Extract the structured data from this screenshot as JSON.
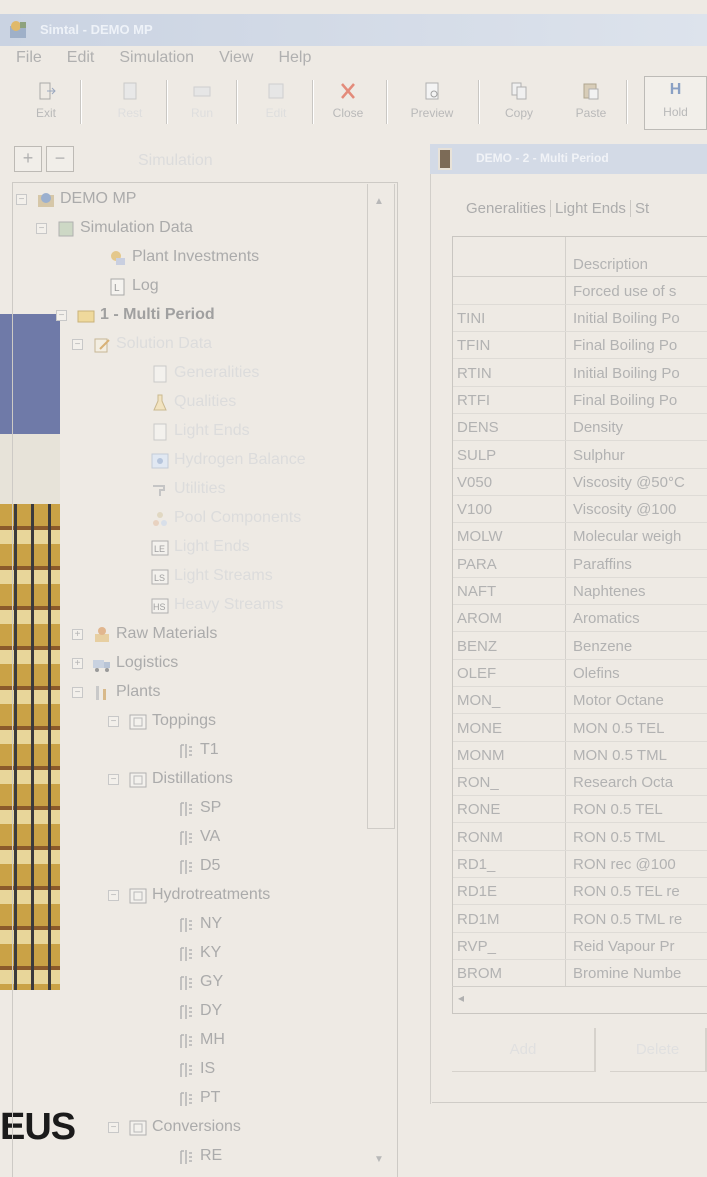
{
  "window": {
    "title": "Simtal - DEMO MP"
  },
  "menu": [
    "File",
    "Edit",
    "Simulation",
    "View",
    "Help"
  ],
  "toolbar": {
    "exit": "Exit",
    "b2": "Rest",
    "b3": "Run",
    "b4": "Edit",
    "close": "Close",
    "preview": "Preview",
    "copy": "Copy",
    "paste": "Paste",
    "hold": "Hold",
    "hold_icon": "H"
  },
  "tree": {
    "header_label": "Simulation",
    "expand_symbol": "+",
    "collapse_symbol": "−",
    "nodes": [
      {
        "label": "DEMO MP"
      },
      {
        "label": "Simulation Data"
      },
      {
        "label": "Plant Investments"
      },
      {
        "label": "Log"
      },
      {
        "label": "1 - Multi Period"
      },
      {
        "label": "Solution Data"
      },
      {
        "label": "Generalities"
      },
      {
        "label": "Qualities"
      },
      {
        "label": "Light Ends"
      },
      {
        "label": "Hydrogen Balance"
      },
      {
        "label": "Utilities"
      },
      {
        "label": "Pool Components"
      },
      {
        "label": "Light Ends"
      },
      {
        "label": "Light Streams"
      },
      {
        "label": "Heavy Streams"
      },
      {
        "label": "Raw Materials"
      },
      {
        "label": "Logistics"
      },
      {
        "label": "Plants"
      },
      {
        "label": "Toppings"
      },
      {
        "label": "T1"
      },
      {
        "label": "Distillations"
      },
      {
        "label": "SP"
      },
      {
        "label": "VA"
      },
      {
        "label": "D5"
      },
      {
        "label": "Hydrotreatments"
      },
      {
        "label": "NY"
      },
      {
        "label": "KY"
      },
      {
        "label": "GY"
      },
      {
        "label": "DY"
      },
      {
        "label": "MH"
      },
      {
        "label": "IS"
      },
      {
        "label": "PT"
      },
      {
        "label": "Conversions"
      },
      {
        "label": "RE"
      }
    ]
  },
  "logo": "EUS",
  "panel": {
    "title": "DEMO - 2 - Multi Period",
    "tabs": [
      "Generalities",
      "Light Ends",
      "St"
    ],
    "col_header": "Description",
    "first_row": "Forced use of s",
    "rows": [
      {
        "code": "TINI",
        "desc": "Initial Boiling Po"
      },
      {
        "code": "TFIN",
        "desc": "Final Boiling Po"
      },
      {
        "code": "RTIN",
        "desc": "Initial Boiling Po"
      },
      {
        "code": "RTFI",
        "desc": "Final Boiling Po"
      },
      {
        "code": "DENS",
        "desc": "Density"
      },
      {
        "code": "SULP",
        "desc": "Sulphur"
      },
      {
        "code": "V050",
        "desc": "Viscosity @50°C"
      },
      {
        "code": "V100",
        "desc": "Viscosity @100"
      },
      {
        "code": "MOLW",
        "desc": "Molecular weigh"
      },
      {
        "code": "PARA",
        "desc": "Paraffins"
      },
      {
        "code": "NAFT",
        "desc": "Naphtenes"
      },
      {
        "code": "AROM",
        "desc": "Aromatics"
      },
      {
        "code": "BENZ",
        "desc": "Benzene"
      },
      {
        "code": "OLEF",
        "desc": "Olefins"
      },
      {
        "code": "MON_",
        "desc": "Motor Octane"
      },
      {
        "code": "MONE",
        "desc": "MON 0.5 TEL"
      },
      {
        "code": "MONM",
        "desc": "MON 0.5 TML"
      },
      {
        "code": "RON_",
        "desc": "Research Octa"
      },
      {
        "code": "RONE",
        "desc": "RON 0.5 TEL"
      },
      {
        "code": "RONM",
        "desc": "RON 0.5 TML"
      },
      {
        "code": "RD1_",
        "desc": "RON rec @100"
      },
      {
        "code": "RD1E",
        "desc": "RON 0.5 TEL re"
      },
      {
        "code": "RD1M",
        "desc": "RON 0.5 TML re"
      },
      {
        "code": "RVP_",
        "desc": "Reid Vapour Pr"
      },
      {
        "code": "BROM",
        "desc": "Bromine Numbe"
      }
    ],
    "scroll_left": "◂",
    "buttons": {
      "ok": "Add",
      "cancel": "Delete"
    }
  }
}
